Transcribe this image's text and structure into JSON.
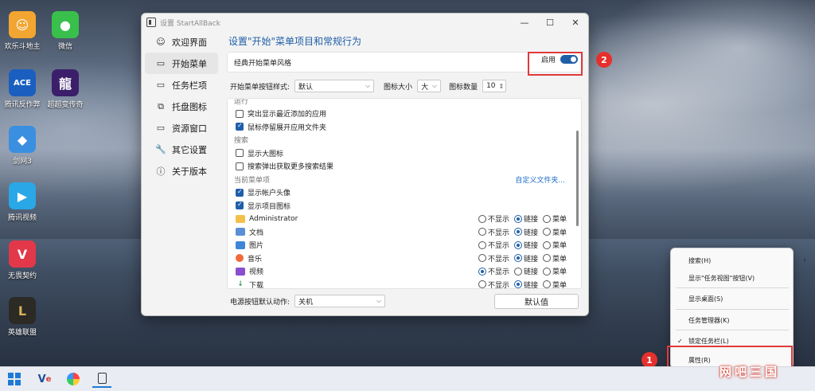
{
  "desktop": {
    "icons": [
      {
        "label": "欢乐斗地主",
        "glyph": "☺",
        "bg": "#f2a531"
      },
      {
        "label": "微信",
        "glyph": "●",
        "bg": "#39c04c"
      },
      {
        "label": "腾讯反作弊",
        "glyph": "ACE",
        "bg": "#1a5fc0"
      },
      {
        "label": "超超变传奇",
        "glyph": "龍",
        "bg": "#3c1f6a"
      },
      {
        "label": "剑网3",
        "glyph": "◆",
        "bg": "#3b8fe0"
      },
      {
        "label": "腾讯视频",
        "glyph": "▶",
        "bg": "#2aa7e6"
      },
      {
        "label": "无畏契约",
        "glyph": "V",
        "bg": "#e2384a"
      },
      {
        "label": "英雄联盟",
        "glyph": "L",
        "bg": "#2b2a24"
      }
    ]
  },
  "window": {
    "title": "设置 StartAllBack",
    "controls": {
      "minimize": "—",
      "maximize": "☐",
      "close": "✕"
    }
  },
  "sidebar": {
    "items": [
      {
        "label": "欢迎界面",
        "icon": "☺"
      },
      {
        "label": "开始菜单",
        "icon": "▭"
      },
      {
        "label": "任务栏项",
        "icon": "▭"
      },
      {
        "label": "托盘图标",
        "icon": "⧉"
      },
      {
        "label": "资源窗口",
        "icon": "▭"
      },
      {
        "label": "其它设置",
        "icon": "🔧"
      },
      {
        "label": "关于版本",
        "icon": "ⓘ"
      }
    ],
    "active_index": 1
  },
  "main": {
    "heading": "设置\"开始\"菜单项目和常规行为",
    "classic_style_label": "经典开始菜单风格",
    "enable_label": "启用",
    "enable_state": true,
    "options": {
      "button_style_label": "开始菜单按钮样式:",
      "button_style_value": "默认",
      "icon_size_label": "图标大小",
      "icon_size_value": "大",
      "icon_count_label": "图标数量",
      "icon_count_value": "10"
    },
    "cut_section": "运行",
    "checkboxes_top": [
      {
        "label": "突出显示最近添加的应用",
        "checked": false
      },
      {
        "label": "鼠标停留展开应用文件夹",
        "checked": true
      }
    ],
    "search_section": "搜索",
    "checkboxes_search": [
      {
        "label": "显示大图标",
        "checked": false
      },
      {
        "label": "搜索弹出获取更多搜索结果",
        "checked": false
      }
    ],
    "current_items_section": "当前菜单项",
    "customize_link": "自定义文件夹...",
    "checkboxes_current": [
      {
        "label": "显示帐户头像",
        "checked": true
      },
      {
        "label": "显示项目图标",
        "checked": true
      }
    ],
    "radio_labels": {
      "hide": "不显示",
      "link": "链接",
      "menu": "菜单"
    },
    "folders": [
      {
        "label": "Administrator",
        "icon": "📁",
        "color": "#f4c04a",
        "selected": "link"
      },
      {
        "label": "文档",
        "icon": "▤",
        "color": "#5b8fd6",
        "selected": "link"
      },
      {
        "label": "图片",
        "icon": "▣",
        "color": "#3d86d8",
        "selected": "link"
      },
      {
        "label": "音乐",
        "icon": "♪",
        "color": "#ef6b3a",
        "selected": "link"
      },
      {
        "label": "视频",
        "icon": "▶",
        "color": "#8a4fd0",
        "selected": "hide"
      },
      {
        "label": "下载",
        "icon": "↓",
        "color": "#3a9a5a",
        "selected": "link"
      }
    ],
    "power_label": "电源按钮默认动作:",
    "power_value": "关机",
    "default_button": "默认值"
  },
  "annotations": {
    "badge1": "1",
    "badge2": "2"
  },
  "context_menu": {
    "items": [
      {
        "label": "搜索(H)",
        "has_submenu": true
      },
      {
        "label": "显示\"任务视图\"按钮(V)"
      },
      {
        "label": "显示桌面(S)"
      },
      {
        "label": "任务管理器(K)"
      },
      {
        "label": "锁定任务栏(L)",
        "checked": true
      },
      {
        "label": "属性(R)"
      }
    ]
  },
  "taskbar": {
    "buttons": [
      "start",
      "vs-editor",
      "color-app",
      "startallback-app"
    ]
  },
  "watermark": "网吧三国",
  "colors": {
    "accent": "#1f5fa8",
    "annotation_red": "#e03a3a"
  }
}
